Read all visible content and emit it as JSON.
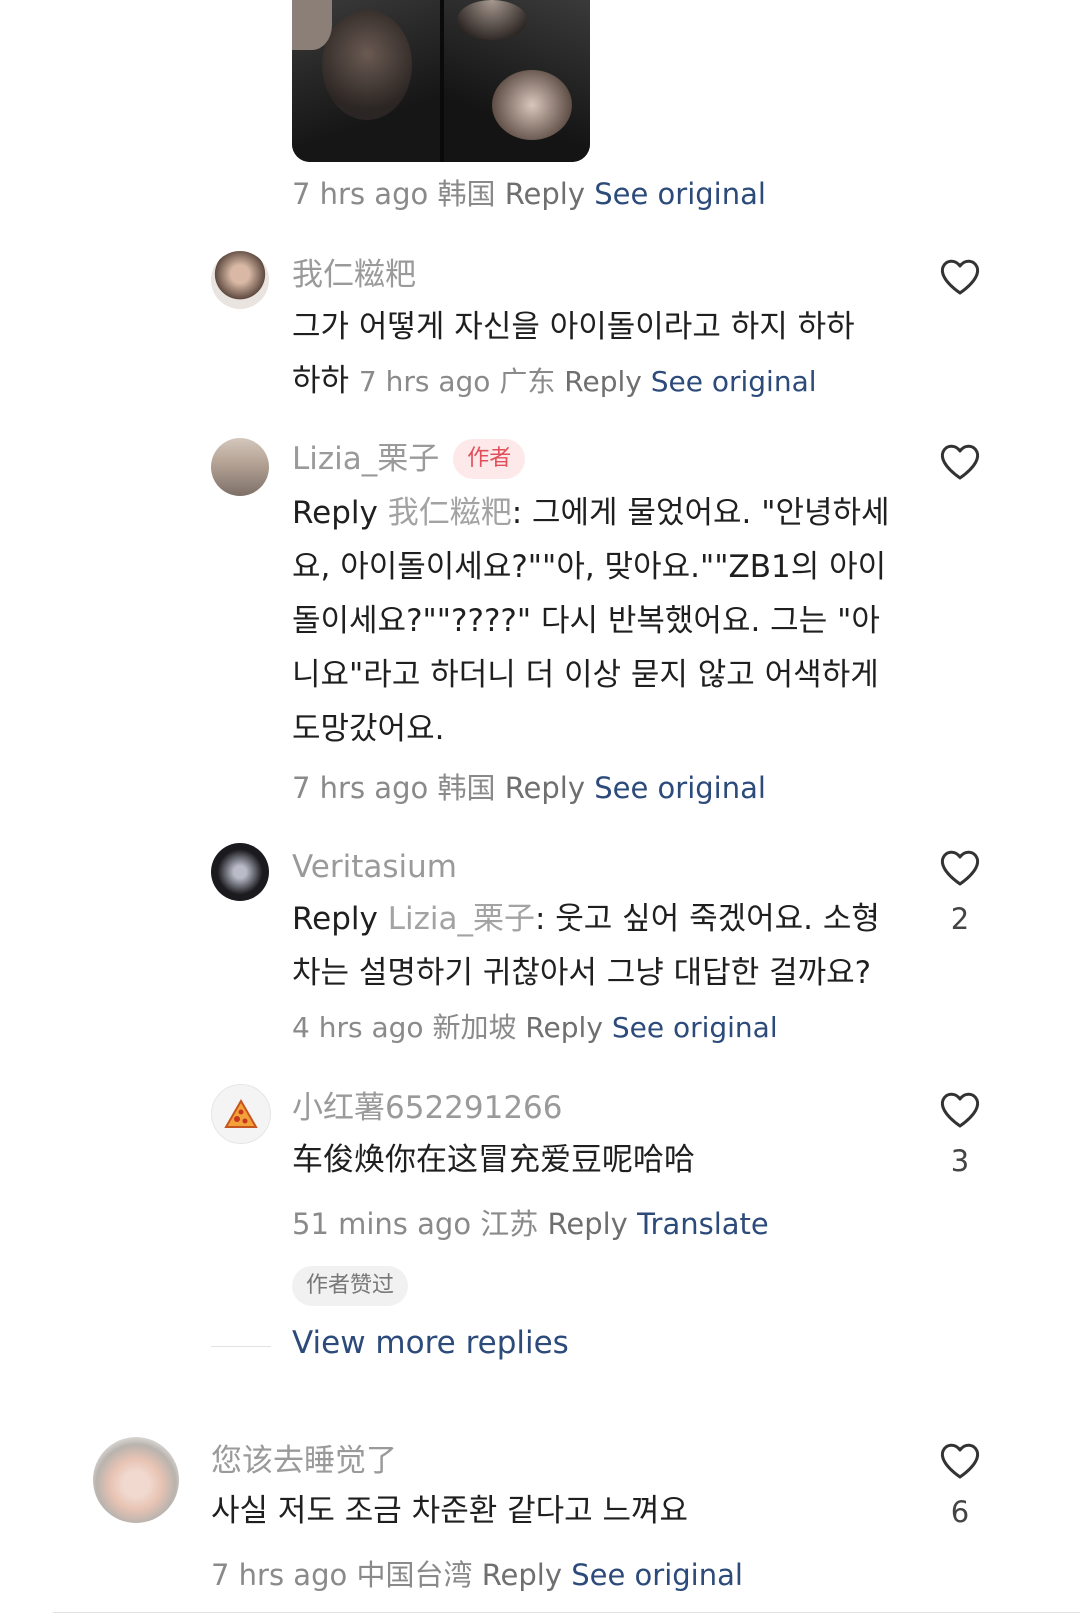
{
  "top_comment_meta": {
    "time": "7 hrs ago",
    "location": "韩国",
    "reply": "Reply",
    "see_original": "See original"
  },
  "replies": [
    {
      "name": "我仁糍粑",
      "text": "그가 어떻게 자신을 아이돌이라고 하지 하하 하하",
      "time": "7 hrs ago",
      "location": "广东",
      "reply": "Reply",
      "action": "See original",
      "likes": ""
    },
    {
      "name": "Lizia_栗子",
      "badge": "作者",
      "reply_prefix": "Reply",
      "reply_to": "我仁糍粑",
      "text": ": 그에게 물었어요. \"안녕하세요, 아이돌이세요?\"\"아, 맞아요.\"\"ZB1의 아이돌이세요?\"\"????\" 다시 반복했어요. 그는 \"아니요\"라고 하더니 더 이상 묻지 않고 어색하게 도망갔어요.",
      "time": "7 hrs ago",
      "location": "韩国",
      "reply": "Reply",
      "action": "See original",
      "likes": ""
    },
    {
      "name": "Veritasium",
      "reply_prefix": "Reply",
      "reply_to": "Lizia_栗子",
      "text": ": 웃고 싶어 죽겠어요. 소형차는 설명하기 귀찮아서 그냥 대답한 걸까요?",
      "time": "4 hrs ago",
      "location": "新加坡",
      "reply": "Reply",
      "action": "See original",
      "likes": "2"
    },
    {
      "name": "小红薯652291266",
      "text": "车俊焕你在这冒充爱豆呢哈哈",
      "time": "51 mins ago",
      "location": "江苏",
      "reply": "Reply",
      "action": "Translate",
      "likes": "3",
      "liked_badge": "作者赞过"
    }
  ],
  "view_more_replies": "View more replies",
  "bottom_comment": {
    "name": "您该去睡觉了",
    "text": "사실 저도 조금 차준환 같다고 느껴요",
    "time": "7 hrs ago",
    "location": "中国台湾",
    "reply": "Reply",
    "action": "See original",
    "likes": "6"
  },
  "colors": {
    "link": "#2c4a7a",
    "author_badge_bg": "#fde9ea",
    "author_badge_text": "#e0505a"
  },
  "icons": [
    "heart-icon"
  ]
}
